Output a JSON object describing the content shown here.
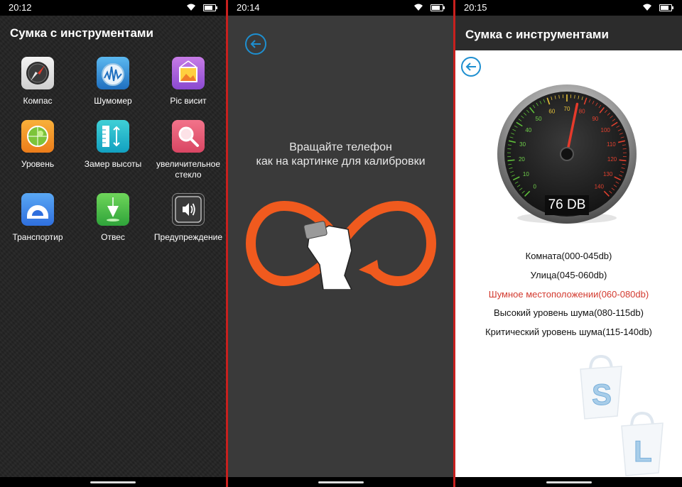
{
  "screen1": {
    "status_time": "20:12",
    "title": "Сумка с инструментами",
    "tools": [
      {
        "label": "Компас",
        "icon": "compass-icon"
      },
      {
        "label": "Шумомер",
        "icon": "noise-meter-icon"
      },
      {
        "label": "Pic висит",
        "icon": "picture-hang-icon"
      },
      {
        "label": "Уровень",
        "icon": "level-icon"
      },
      {
        "label": "Замер высоты",
        "icon": "height-measure-icon"
      },
      {
        "label": "увеличительное стекло",
        "icon": "magnifier-icon"
      },
      {
        "label": "Транспортир",
        "icon": "protractor-icon"
      },
      {
        "label": "Отвес",
        "icon": "plumb-icon"
      },
      {
        "label": "Предупреждение",
        "icon": "speaker-icon"
      }
    ]
  },
  "screen2": {
    "status_time": "20:14",
    "instruction_line1": "Вращайте телефон",
    "instruction_line2": "как на картинке для калибровки"
  },
  "screen3": {
    "status_time": "20:15",
    "title": "Сумка с инструментами",
    "gauge": {
      "reading": "76 DB",
      "value_db": 76,
      "scale_min": 0,
      "scale_max": 140,
      "tick_labels": [
        "0",
        "10",
        "20",
        "30",
        "40",
        "50",
        "60",
        "70",
        "80",
        "90",
        "100",
        "110",
        "120",
        "130",
        "140"
      ]
    },
    "ranges": [
      {
        "label": "Комната(000-045db)",
        "active": false
      },
      {
        "label": "Улица(045-060db)",
        "active": false
      },
      {
        "label": "Шумное местоположении(060-080db)",
        "active": true
      },
      {
        "label": "Высокий уровень шума(080-115db)",
        "active": false
      },
      {
        "label": "Критический уровень шума(115-140db)",
        "active": false
      }
    ],
    "watermark_letters": [
      "S",
      "L"
    ]
  },
  "colors": {
    "separator": "#c8201e",
    "accent_blue": "#1e8fd0",
    "active_range": "#d33a2f",
    "calibration_orange": "#f05a1e"
  }
}
